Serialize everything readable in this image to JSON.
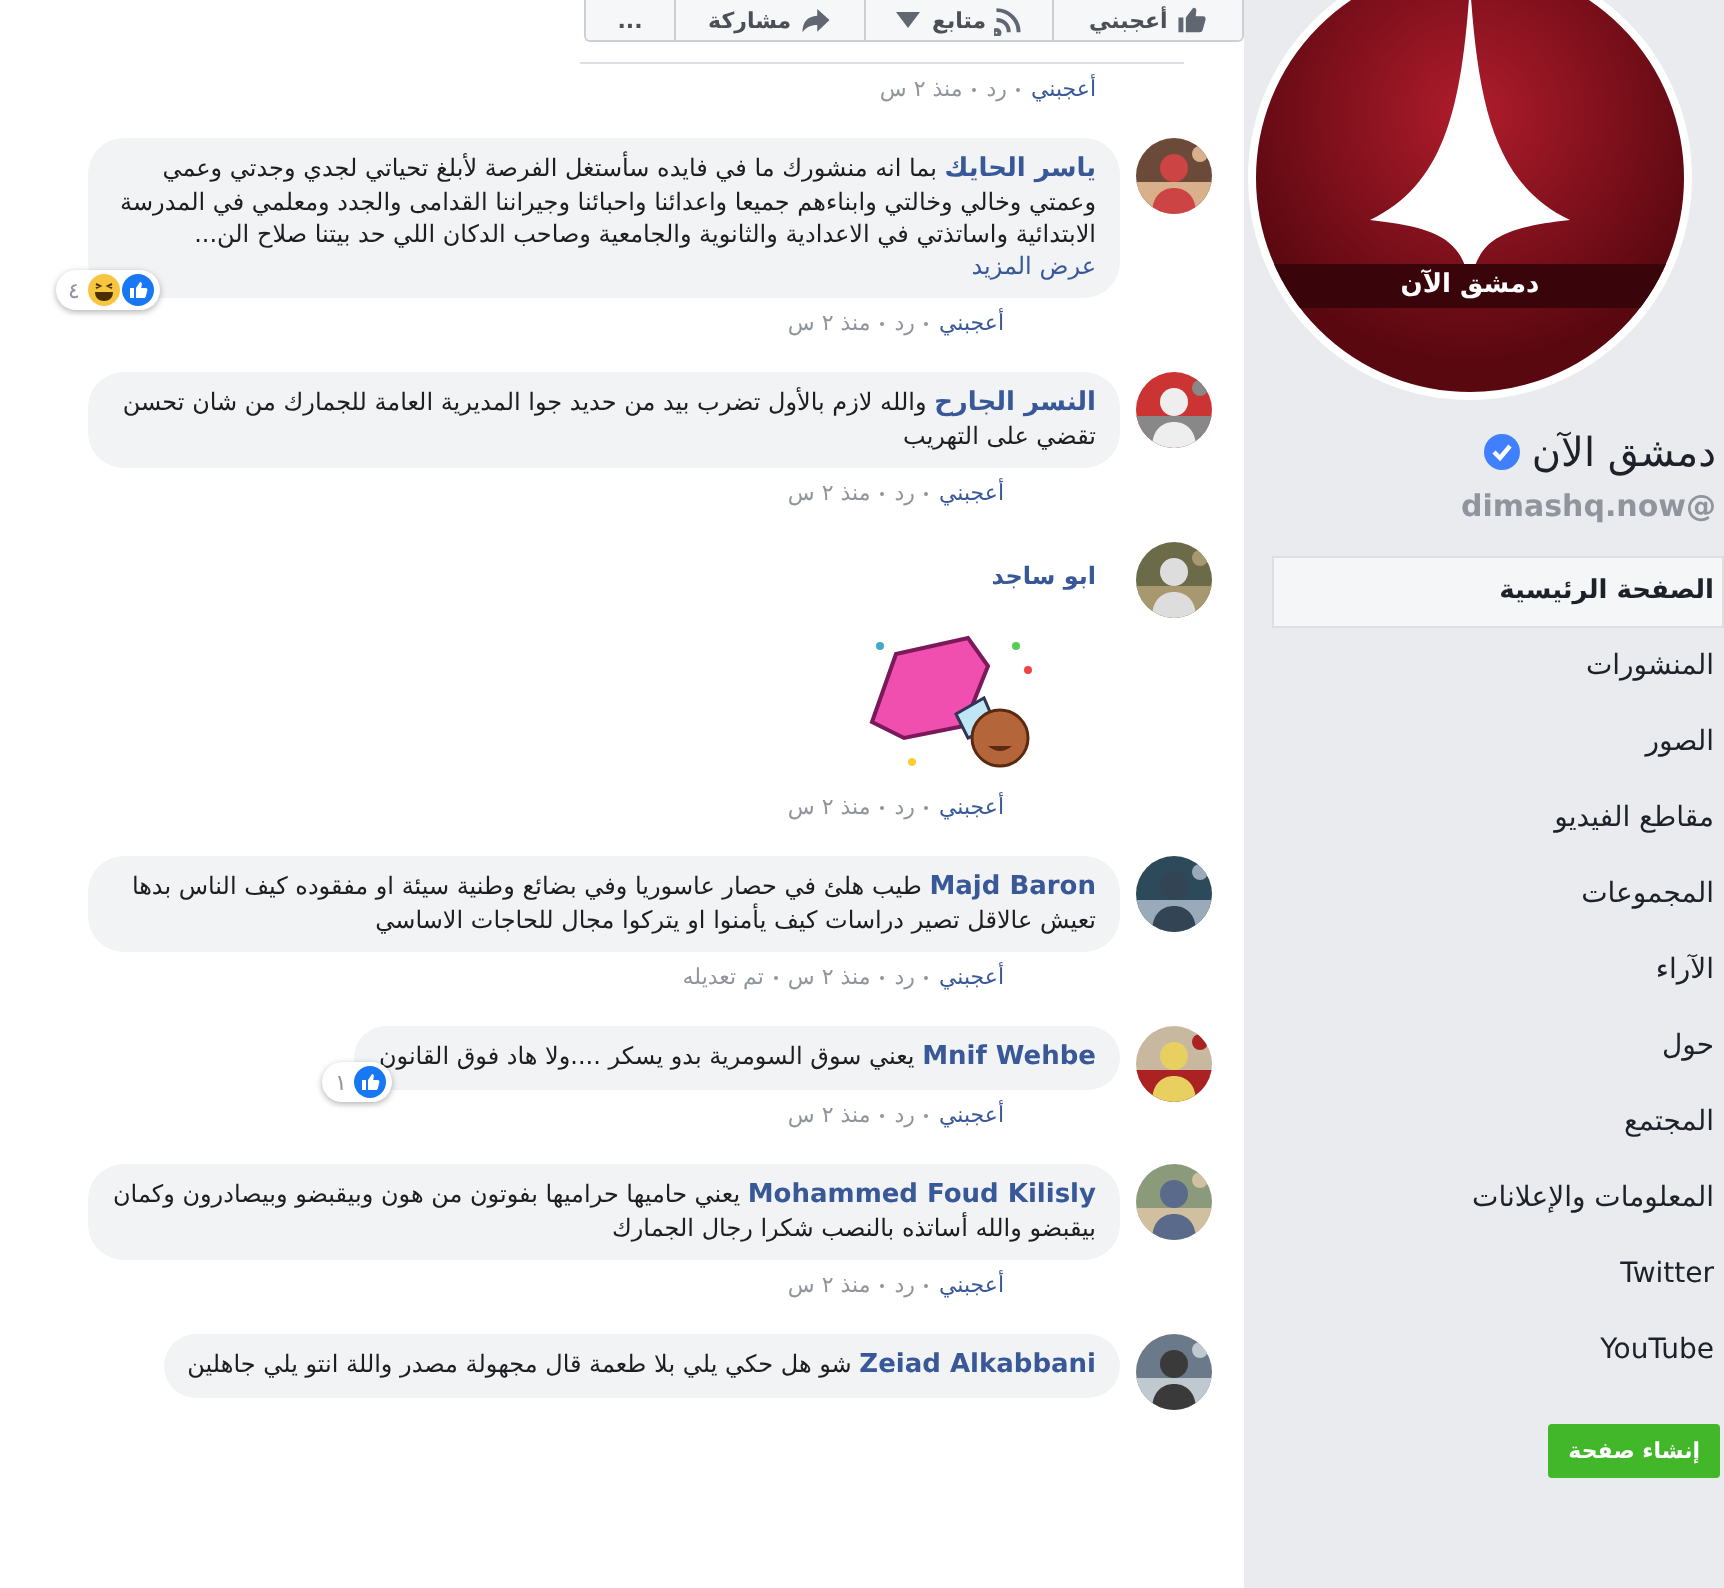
{
  "post_actions": [
    {
      "kind": "like",
      "label": "أعجبني"
    },
    {
      "kind": "follow",
      "label": "متابع"
    },
    {
      "kind": "share",
      "label": "مشاركة"
    },
    {
      "kind": "more",
      "label": "..."
    }
  ],
  "top_meta": [
    {
      "kind": "like",
      "text": "أعجبني"
    },
    {
      "kind": "reply",
      "text": "رد"
    },
    {
      "kind": "time",
      "text": "منذ ٢ س"
    }
  ],
  "comments": [
    {
      "kind": "text",
      "name": "ياسر الحايك",
      "text": "بما انه منشورك ما في فايده سأستغل الفرصة لأبلغ تحياتي لجدي وجدتي وعمي وعمتي وخالي وخالتي وابناءهم جميعا واعدائنا واحبائنا وجيراننا القدامى والجدد ومعلمي في المدرسة الابتدائية واساتذتي في الاعدادية والثانوية والجامعية وصاحب الدكان اللي حد بيتنا صلاح الن...",
      "more": "عرض المزيد",
      "reactions": {
        "count": "٤",
        "icons": [
          {
            "kind": "like"
          },
          {
            "kind": "haha"
          }
        ]
      },
      "meta": [
        {
          "kind": "like",
          "text": "أعجبني"
        },
        {
          "kind": "reply",
          "text": "رد"
        },
        {
          "kind": "time",
          "text": "منذ ٢ س"
        }
      ]
    },
    {
      "kind": "text",
      "name": "النسر الجارح",
      "text": "والله لازم بالأول تضرب بيد من حديد جوا المديرية العامة للجمارك من شان تحسن تقضي على التهريب",
      "meta": [
        {
          "kind": "like",
          "text": "أعجبني"
        },
        {
          "kind": "reply",
          "text": "رد"
        },
        {
          "kind": "time",
          "text": "منذ ٢ س"
        }
      ]
    },
    {
      "kind": "sticker",
      "name": "ابو ساجد",
      "meta": [
        {
          "kind": "like",
          "text": "أعجبني"
        },
        {
          "kind": "reply",
          "text": "رد"
        },
        {
          "kind": "time",
          "text": "منذ ٢ س"
        }
      ]
    },
    {
      "kind": "text",
      "name": "Majd Baron",
      "text": "طيب هلئ في حصار عاسوريا وفي بضائع وطنية سيئة او مفقوده كيف الناس بدها تعيش عالاقل تصير دراسات كيف يأمنوا او يتركوا مجال للحاجات الاساسي",
      "meta": [
        {
          "kind": "like",
          "text": "أعجبني"
        },
        {
          "kind": "reply",
          "text": "رد"
        },
        {
          "kind": "time",
          "text": "منذ ٢ س"
        },
        {
          "kind": "edited",
          "text": "تم تعديله"
        }
      ]
    },
    {
      "kind": "text",
      "name": "Mnif Wehbe",
      "text": "يعني سوق السومرية بدو يسكر ....ولا هاد فوق القانون",
      "reactions": {
        "count": "١",
        "icons": [
          {
            "kind": "like"
          }
        ]
      },
      "meta": [
        {
          "kind": "like",
          "text": "أعجبني"
        },
        {
          "kind": "reply",
          "text": "رد"
        },
        {
          "kind": "time",
          "text": "منذ ٢ س"
        }
      ]
    },
    {
      "kind": "text",
      "name": "Mohammed Foud Kilisly",
      "text": "يعني حاميها حراميها بفوتون من هون وبيقبضو وبيصادرون وكمان بيقبضو والله أساتذه بالنصب شكرا رجال الجمارك",
      "meta": [
        {
          "kind": "like",
          "text": "أعجبني"
        },
        {
          "kind": "reply",
          "text": "رد"
        },
        {
          "kind": "time",
          "text": "منذ ٢ س"
        }
      ]
    },
    {
      "kind": "text",
      "name": "Zeiad Alkabbani",
      "text": "شو هل حكي يلي بلا طعمة قال مجهولة مصدر واللة انتو يلي جاهلين"
    }
  ],
  "page": {
    "logo_text": "دمشق الآن",
    "name": "دمشق الآن",
    "verified": true,
    "handle": "@dimashq.now"
  },
  "nav": [
    {
      "label": "الصفحة الرئيسية",
      "selected": true
    },
    {
      "label": "المنشورات",
      "selected": false
    },
    {
      "label": "الصور",
      "selected": false
    },
    {
      "label": "مقاطع الفيديو",
      "selected": false
    },
    {
      "label": "المجموعات",
      "selected": false
    },
    {
      "label": "الآراء",
      "selected": false
    },
    {
      "label": "حول",
      "selected": false
    },
    {
      "label": "المجتمع",
      "selected": false
    },
    {
      "label": "المعلومات والإعلانات",
      "selected": false
    },
    {
      "label": "Twitter",
      "selected": false
    },
    {
      "label": "YouTube",
      "selected": false
    }
  ],
  "create_page_button": "إنشاء صفحة"
}
